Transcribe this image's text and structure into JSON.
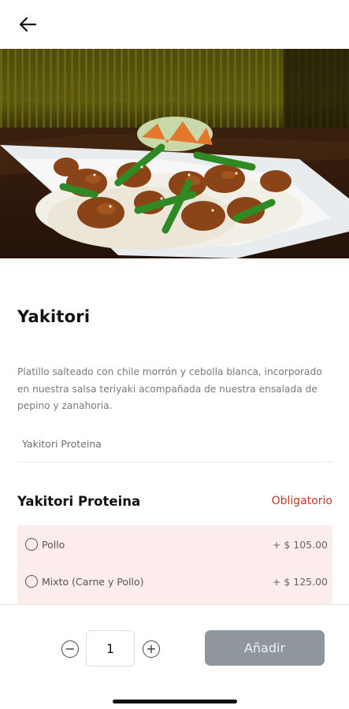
{
  "product": {
    "title": "Yakitori",
    "description": "Platillo salteado con chile morrón y cebolla blanca, incorporado en nuestra salsa teriyaki acompañada de nuestra ensalada de pepino y zanahoria.",
    "selected_summary": "Yakitori Proteina",
    "image_alt": "Yakitori dish"
  },
  "section": {
    "title": "Yakitori Proteina",
    "required_label": "Obligatorio",
    "options": [
      {
        "label": "Pollo",
        "price": "+ $ 105.00"
      },
      {
        "label": "Mixto (Carne y Pollo)",
        "price": "+ $ 125.00"
      }
    ]
  },
  "cart": {
    "quantity": "1",
    "minus_symbol": "−",
    "plus_symbol": "+",
    "add_label": "Añadir"
  },
  "icons": {
    "back": "arrow-left-icon"
  },
  "colors": {
    "required": "#c6392b",
    "option_bg": "#fdecec",
    "add_button": "#8f979e"
  }
}
